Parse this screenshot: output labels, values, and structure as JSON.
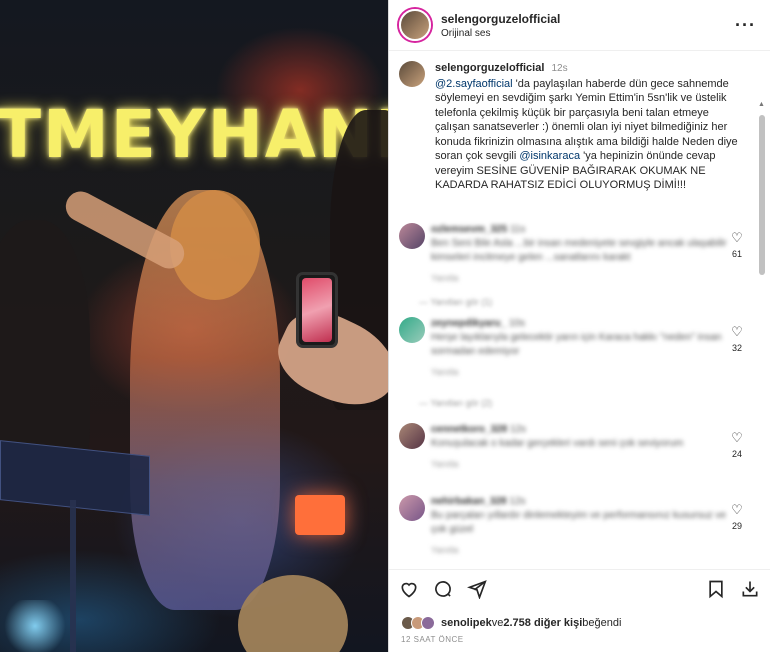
{
  "post": {
    "username": "selengorguzelofficial",
    "audio": "Orijinal ses",
    "more_icon": "ellipsis-icon"
  },
  "video": {
    "sign_text": "TMEYHANE"
  },
  "caption": {
    "username": "selengorguzelofficial",
    "time": "12s",
    "mention1": "@2.sayfaofficial",
    "text1": " 'da paylaşılan haberde dün gece sahnemde söylemeyi en sevdiğim şarkı Yemin Ettim'in 5sn'lik ve üstelik telefonla çekilmiş küçük bir parçasıyla beni talan etmeye çalışan sanatseverler :) önemli olan iyi niyet bilmediğiniz her konuda fikrinizin olmasına alıştık ama bildiği halde Neden diye soran çok sevgili ",
    "mention2": "@isinkaraca",
    "text2": " 'ya hepinizin önünde cevap vereyim SESİNE GÜVENİP BAĞIRARAK OKUMAK NE KADARDA RAHATSIZ EDİCİ OLUYORMUŞ DİMİ!!!"
  },
  "comments": [
    {
      "user": "ozlemsevm_325",
      "time": "11s",
      "text": "Ben Seni Bile Asla ...bir insan medeniyete sevgiyle ancak ulaşabilir kimseleri incitmeye gelen ...sanatlarını karakt",
      "meta": "Yanıtla",
      "likes": "61",
      "replies": "— Yanıtları gör (1)"
    },
    {
      "user": "zeynepdikyaru_",
      "time": "10s",
      "text": "Herşe layıklarıyla gelecektir yarın için Karaca hakkı \"neden\" insan sormadan edemiyor",
      "meta": "Yanıtla",
      "likes": "32",
      "replies": "— Yanıtları gör (2)"
    },
    {
      "user": "cennetkoro_328",
      "time": "12s",
      "text": "Konuşulacak o kadar gerçekleri vardı seni çok seviyorum",
      "meta": "Yanıtla",
      "likes": "24",
      "replies": ""
    },
    {
      "user": "nehirbakan_328",
      "time": "12s",
      "text": "Bu parçaları yıllardır dinlemekteyim ve performansınız kusursuz ve çok güzel",
      "meta": "Yanıtla",
      "likes": "29",
      "replies": ""
    }
  ],
  "actions": {
    "like_icon": "heart-icon",
    "comment_icon": "comment-icon",
    "share_icon": "share-icon",
    "save_icon": "bookmark-icon",
    "download_icon": "download-icon"
  },
  "likes_line": {
    "first_user": "senolipek",
    "connector": " ve ",
    "count": "2.758 diğer kişi",
    "suffix": " beğendi"
  },
  "timestamp": "12 SAAT ÖNCE"
}
